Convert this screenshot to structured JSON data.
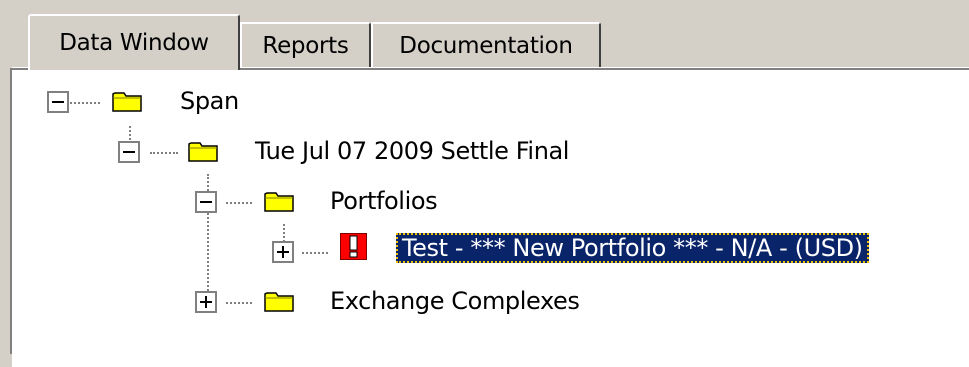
{
  "tabs": [
    {
      "label": "Data Window",
      "active": true
    },
    {
      "label": "Reports",
      "active": false
    },
    {
      "label": "Documentation",
      "active": false
    }
  ],
  "tree": {
    "root": {
      "label": "Span",
      "icon": "folder-icon",
      "expanded": true
    },
    "session": {
      "label": "Tue Jul 07 2009 Settle Final",
      "icon": "folder-icon",
      "expanded": true
    },
    "portfolios": {
      "label": "Portfolios",
      "icon": "folder-icon",
      "expanded": true
    },
    "portfolio_item": {
      "label": "Test - *** New Portfolio *** - N/A - (USD)",
      "icon": "warning-icon",
      "expanded": false,
      "selected": true
    },
    "exchange_complexes": {
      "label": "Exchange Complexes",
      "icon": "folder-icon",
      "expanded": false
    }
  },
  "colors": {
    "window_bg": "#d4d0c8",
    "panel_bg": "#ffffff",
    "selection_bg": "#0a246a",
    "selection_fg": "#ffffff",
    "folder_fill": "#ffff00",
    "alert_fill": "#ff0000"
  }
}
